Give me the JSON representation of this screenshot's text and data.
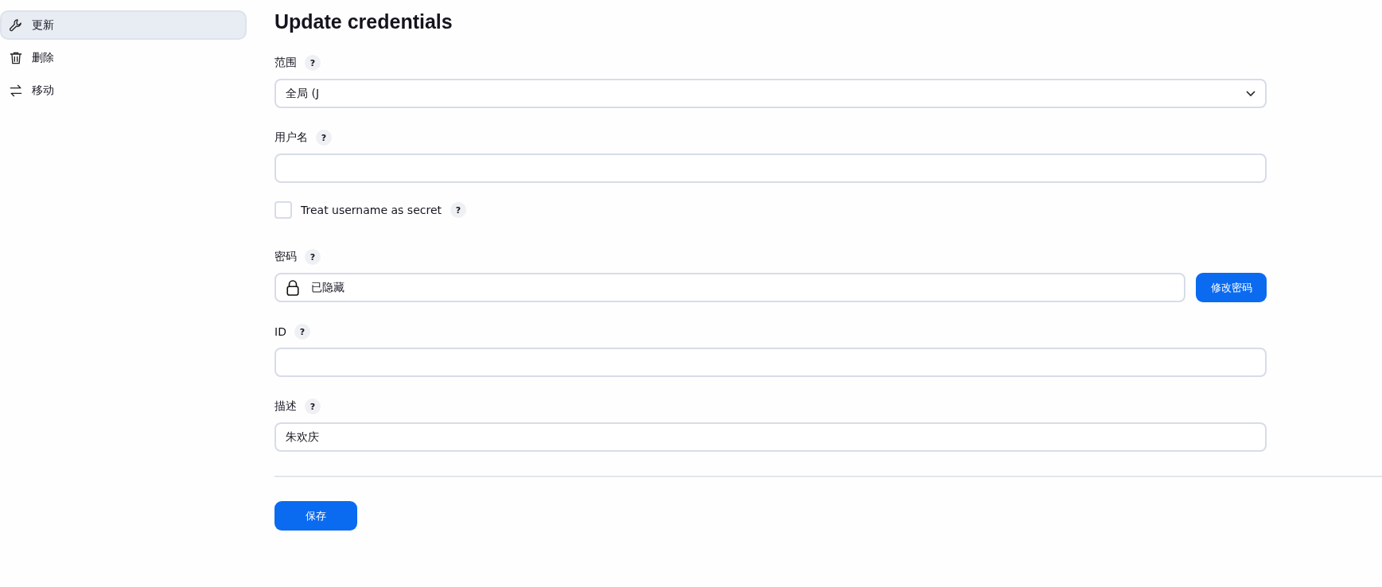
{
  "sidebar": {
    "items": [
      {
        "label": "更新",
        "kind": "wrench",
        "selected": true
      },
      {
        "label": "删除",
        "kind": "trash",
        "selected": false
      },
      {
        "label": "移动",
        "kind": "swap",
        "selected": false
      }
    ]
  },
  "title": "Update credentials",
  "fields": [
    {
      "kind": "select",
      "label": "范围",
      "help": "?",
      "value": "全局 (J"
    },
    {
      "kind": "text",
      "label": "用户名",
      "help": "?"
    },
    {
      "kind": "checkbox",
      "label": "Treat username as secret",
      "help": "?",
      "checked": false
    },
    {
      "kind": "secret",
      "label": "密码",
      "help": "?",
      "value": "已隐藏",
      "button": "修改密码"
    },
    {
      "kind": "text",
      "label": "ID",
      "help": "?"
    },
    {
      "kind": "text",
      "label": "描述",
      "help": "?",
      "value": "朱欢庆"
    }
  ],
  "save_button": "保存"
}
